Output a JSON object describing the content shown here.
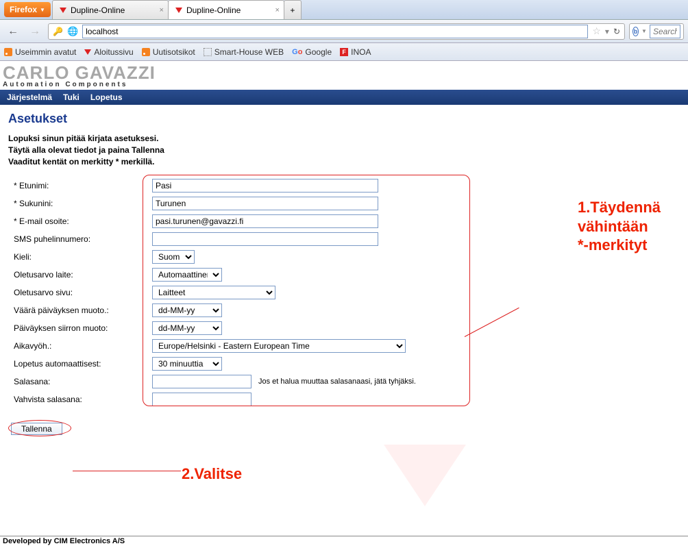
{
  "browser": {
    "button": "Firefox",
    "tabs": [
      {
        "title": "Dupline-Online"
      },
      {
        "title": "Dupline-Online"
      }
    ],
    "url": "localhost",
    "search_placeholder": "Search th"
  },
  "bookmarks": [
    {
      "label": "Useimmin avatut"
    },
    {
      "label": "Aloitussivu"
    },
    {
      "label": "Uutisotsikot"
    },
    {
      "label": "Smart-House WEB"
    },
    {
      "label": "Google"
    },
    {
      "label": "INOA"
    }
  ],
  "logo": {
    "main": "CARLO GAVAZZI",
    "sub": "Automation Components"
  },
  "menu": [
    "Järjestelmä",
    "Tuki",
    "Lopetus"
  ],
  "page": {
    "title": "Asetukset",
    "intro1": "Lopuksi sinun pitää kirjata asetuksesi.",
    "intro2": "Täytä alla olevat tiedot ja paina Tallenna",
    "intro3": "Vaaditut kentät on merkitty * merkillä."
  },
  "form": {
    "etunimi_label": "* Etunimi:",
    "etunimi": "Pasi",
    "sukunimi_label": "* Sukunini:",
    "sukunimi": "Turunen",
    "email_label": "* E-mail osoite:",
    "email": "pasi.turunen@gavazzi.fi",
    "sms_label": "SMS puhelinnumero:",
    "sms": "",
    "kieli_label": "Kieli:",
    "kieli": "Suomi",
    "olet_laite_label": "Oletusarvo laite:",
    "olet_laite": "Automaattinen",
    "olet_sivu_label": "Oletusarvo sivu:",
    "olet_sivu": "Laitteet",
    "vaara_pvm_label": "Väärä päiväyksen muoto.:",
    "vaara_pvm": "dd-MM-yy",
    "pvm_siirto_label": "Päiväyksen siirron muoto:",
    "pvm_siirto": "dd-MM-yy",
    "aikavyoh_label": "Aikavyöh.:",
    "aikavyoh": "Europe/Helsinki - Eastern European Time",
    "lopetus_label": "Lopetus automaattisest:",
    "lopetus": "30 minuuttia",
    "salasana_label": "Salasana:",
    "salasana_hint": "Jos et halua muuttaa salasanaasi, jätä tyhjäksi.",
    "vahvista_label": "Vahvista salasana:",
    "save": "Tallenna"
  },
  "annotations": {
    "a1_l1": "1.Täydennä",
    "a1_l2": "vähintään",
    "a1_l3": "*-merkityt",
    "a2": "2.Valitse"
  },
  "footer": "Developed by CIM Electronics A/S"
}
